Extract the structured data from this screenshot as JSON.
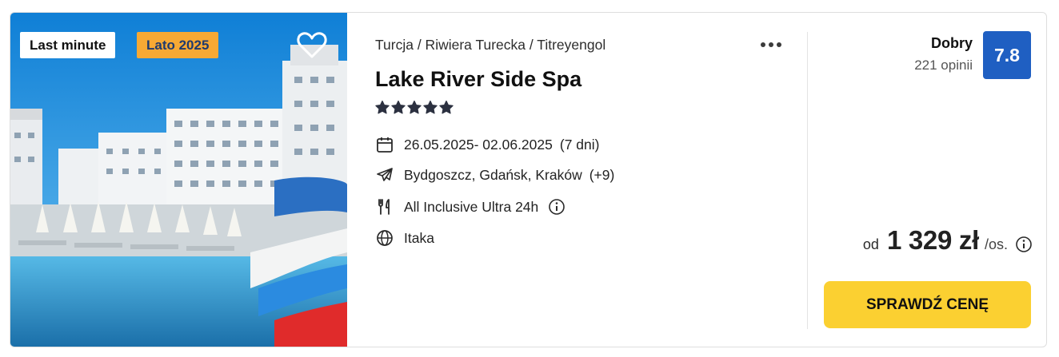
{
  "badges": {
    "last_minute": "Last minute",
    "season": "Lato 2025"
  },
  "breadcrumb": "Turcja / Riwiera Turecka / Titreyengol",
  "hotel": {
    "name": "Lake River Side Spa",
    "stars": 5
  },
  "details": {
    "dates": "26.05.2025- 02.06.2025",
    "duration": "(7 dni)",
    "departure": "Bydgoszcz, Gdańsk, Kraków",
    "departure_more": "(+9)",
    "board": "All Inclusive Ultra 24h",
    "operator": "Itaka"
  },
  "rating": {
    "label": "Dobry",
    "reviews": "221 opinii",
    "score": "7.8"
  },
  "price": {
    "prefix": "od",
    "amount": "1 329 zł",
    "suffix": "/os."
  },
  "cta": "SPRAWDŹ CENĘ",
  "colors": {
    "badge_season": "#f7a934",
    "score_bg": "#1f5fc2",
    "cta_bg": "#fbd031"
  },
  "icons": [
    "heart-icon",
    "more-dots-icon",
    "star-icon",
    "calendar-icon",
    "plane-icon",
    "cutlery-icon",
    "info-icon",
    "globe-icon"
  ]
}
